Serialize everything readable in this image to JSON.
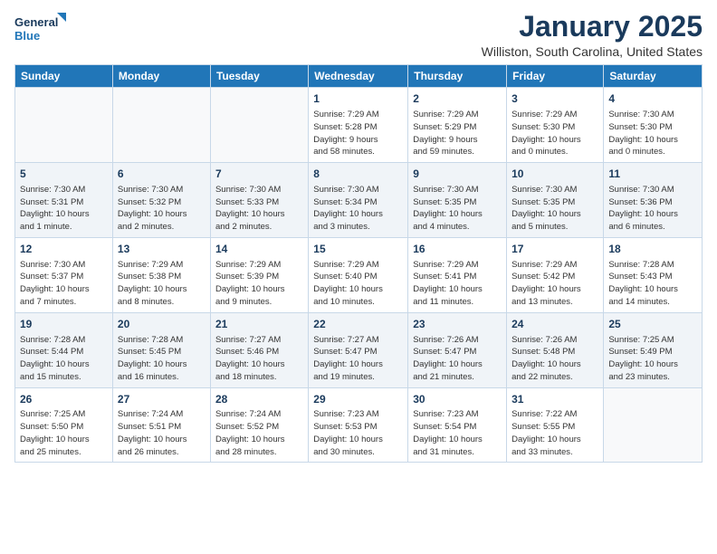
{
  "logo": {
    "line1": "General",
    "line2": "Blue"
  },
  "title": "January 2025",
  "location": "Williston, South Carolina, United States",
  "days_of_week": [
    "Sunday",
    "Monday",
    "Tuesday",
    "Wednesday",
    "Thursday",
    "Friday",
    "Saturday"
  ],
  "weeks": [
    [
      {
        "day": "",
        "info": ""
      },
      {
        "day": "",
        "info": ""
      },
      {
        "day": "",
        "info": ""
      },
      {
        "day": "1",
        "info": "Sunrise: 7:29 AM\nSunset: 5:28 PM\nDaylight: 9 hours\nand 58 minutes."
      },
      {
        "day": "2",
        "info": "Sunrise: 7:29 AM\nSunset: 5:29 PM\nDaylight: 9 hours\nand 59 minutes."
      },
      {
        "day": "3",
        "info": "Sunrise: 7:29 AM\nSunset: 5:30 PM\nDaylight: 10 hours\nand 0 minutes."
      },
      {
        "day": "4",
        "info": "Sunrise: 7:30 AM\nSunset: 5:30 PM\nDaylight: 10 hours\nand 0 minutes."
      }
    ],
    [
      {
        "day": "5",
        "info": "Sunrise: 7:30 AM\nSunset: 5:31 PM\nDaylight: 10 hours\nand 1 minute."
      },
      {
        "day": "6",
        "info": "Sunrise: 7:30 AM\nSunset: 5:32 PM\nDaylight: 10 hours\nand 2 minutes."
      },
      {
        "day": "7",
        "info": "Sunrise: 7:30 AM\nSunset: 5:33 PM\nDaylight: 10 hours\nand 2 minutes."
      },
      {
        "day": "8",
        "info": "Sunrise: 7:30 AM\nSunset: 5:34 PM\nDaylight: 10 hours\nand 3 minutes."
      },
      {
        "day": "9",
        "info": "Sunrise: 7:30 AM\nSunset: 5:35 PM\nDaylight: 10 hours\nand 4 minutes."
      },
      {
        "day": "10",
        "info": "Sunrise: 7:30 AM\nSunset: 5:35 PM\nDaylight: 10 hours\nand 5 minutes."
      },
      {
        "day": "11",
        "info": "Sunrise: 7:30 AM\nSunset: 5:36 PM\nDaylight: 10 hours\nand 6 minutes."
      }
    ],
    [
      {
        "day": "12",
        "info": "Sunrise: 7:30 AM\nSunset: 5:37 PM\nDaylight: 10 hours\nand 7 minutes."
      },
      {
        "day": "13",
        "info": "Sunrise: 7:29 AM\nSunset: 5:38 PM\nDaylight: 10 hours\nand 8 minutes."
      },
      {
        "day": "14",
        "info": "Sunrise: 7:29 AM\nSunset: 5:39 PM\nDaylight: 10 hours\nand 9 minutes."
      },
      {
        "day": "15",
        "info": "Sunrise: 7:29 AM\nSunset: 5:40 PM\nDaylight: 10 hours\nand 10 minutes."
      },
      {
        "day": "16",
        "info": "Sunrise: 7:29 AM\nSunset: 5:41 PM\nDaylight: 10 hours\nand 11 minutes."
      },
      {
        "day": "17",
        "info": "Sunrise: 7:29 AM\nSunset: 5:42 PM\nDaylight: 10 hours\nand 13 minutes."
      },
      {
        "day": "18",
        "info": "Sunrise: 7:28 AM\nSunset: 5:43 PM\nDaylight: 10 hours\nand 14 minutes."
      }
    ],
    [
      {
        "day": "19",
        "info": "Sunrise: 7:28 AM\nSunset: 5:44 PM\nDaylight: 10 hours\nand 15 minutes."
      },
      {
        "day": "20",
        "info": "Sunrise: 7:28 AM\nSunset: 5:45 PM\nDaylight: 10 hours\nand 16 minutes."
      },
      {
        "day": "21",
        "info": "Sunrise: 7:27 AM\nSunset: 5:46 PM\nDaylight: 10 hours\nand 18 minutes."
      },
      {
        "day": "22",
        "info": "Sunrise: 7:27 AM\nSunset: 5:47 PM\nDaylight: 10 hours\nand 19 minutes."
      },
      {
        "day": "23",
        "info": "Sunrise: 7:26 AM\nSunset: 5:47 PM\nDaylight: 10 hours\nand 21 minutes."
      },
      {
        "day": "24",
        "info": "Sunrise: 7:26 AM\nSunset: 5:48 PM\nDaylight: 10 hours\nand 22 minutes."
      },
      {
        "day": "25",
        "info": "Sunrise: 7:25 AM\nSunset: 5:49 PM\nDaylight: 10 hours\nand 23 minutes."
      }
    ],
    [
      {
        "day": "26",
        "info": "Sunrise: 7:25 AM\nSunset: 5:50 PM\nDaylight: 10 hours\nand 25 minutes."
      },
      {
        "day": "27",
        "info": "Sunrise: 7:24 AM\nSunset: 5:51 PM\nDaylight: 10 hours\nand 26 minutes."
      },
      {
        "day": "28",
        "info": "Sunrise: 7:24 AM\nSunset: 5:52 PM\nDaylight: 10 hours\nand 28 minutes."
      },
      {
        "day": "29",
        "info": "Sunrise: 7:23 AM\nSunset: 5:53 PM\nDaylight: 10 hours\nand 30 minutes."
      },
      {
        "day": "30",
        "info": "Sunrise: 7:23 AM\nSunset: 5:54 PM\nDaylight: 10 hours\nand 31 minutes."
      },
      {
        "day": "31",
        "info": "Sunrise: 7:22 AM\nSunset: 5:55 PM\nDaylight: 10 hours\nand 33 minutes."
      },
      {
        "day": "",
        "info": ""
      }
    ]
  ]
}
